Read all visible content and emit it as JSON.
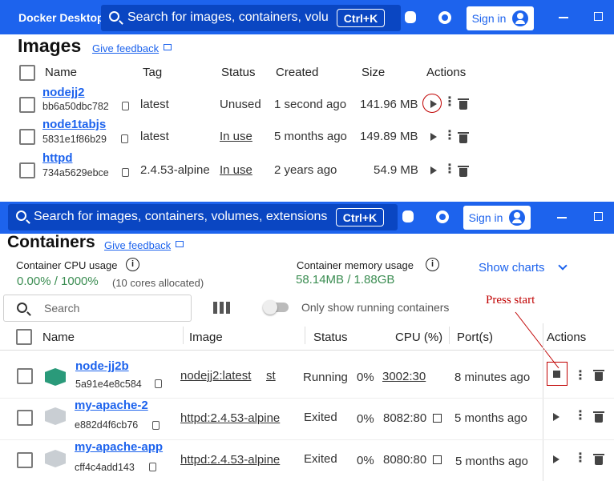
{
  "top": {
    "app_title": "Docker Desktop",
    "search_placeholder": "Search for images, containers, volum",
    "shortcut": "Ctrl+K",
    "signin": "Sign in"
  },
  "images": {
    "title": "Images",
    "feedback": "Give feedback",
    "columns": [
      "Name",
      "Tag",
      "Status",
      "Created",
      "Size",
      "Actions"
    ],
    "rows": [
      {
        "name": "nodejj2",
        "id": "bb6a50dbc782",
        "tag": "latest",
        "status": "Unused",
        "created": "1 second ago",
        "size": "141.96 MB"
      },
      {
        "name": "node1tabjs",
        "id": "5831e1f86b29",
        "tag": "latest",
        "status": "In use",
        "created": "5 months ago",
        "size": "149.89 MB"
      },
      {
        "name": "httpd",
        "id": "734a5629ebce",
        "tag": "2.4.53-alpine",
        "status": "In use",
        "created": "2 years ago",
        "size": "54.9 MB"
      }
    ]
  },
  "top2": {
    "search_placeholder": "Search for images, containers, volumes, extensions d",
    "shortcut": "Ctrl+K",
    "signin": "Sign in"
  },
  "containers": {
    "title": "Containers",
    "feedback": "Give feedback",
    "cpu_label": "Container CPU usage",
    "cpu_value": "0.00% / 1000%",
    "cpu_note": "(10 cores allocated)",
    "mem_label": "Container memory usage",
    "mem_value": "58.14MB / 1.88GB",
    "show_charts": "Show charts",
    "search_placeholder": "Search",
    "toggle_label": "Only show running containers",
    "annotation": "Press start",
    "columns": [
      "Name",
      "Image",
      "Status",
      "CPU (%)",
      "Port(s)",
      "Actions"
    ],
    "rows": [
      {
        "name": "node-jj2b",
        "id": "5a91e4e8c584",
        "image": "nodejj2:latest",
        "image_suffix": "st",
        "status": "Running",
        "cpu": "0%",
        "port": "3002:30",
        "last": "8 minutes ago"
      },
      {
        "name": "my-apache-2",
        "id": "e882d4f6cb76",
        "image": "httpd:2.4.53-alpine",
        "status": "Exited",
        "cpu": "0%",
        "port": "8082:80",
        "last": "5 months ago"
      },
      {
        "name": "my-apache-app",
        "id": "cff4c4add143",
        "image": "httpd:2.4.53-alpine",
        "status": "Exited",
        "cpu": "0%",
        "port": "8080:80",
        "last": "5 months ago"
      }
    ]
  },
  "colors": {
    "brand_blue": "#1d63ed",
    "search_blue": "#0a46c2",
    "green": "#3b8d52",
    "annotation_red": "#c00000"
  }
}
